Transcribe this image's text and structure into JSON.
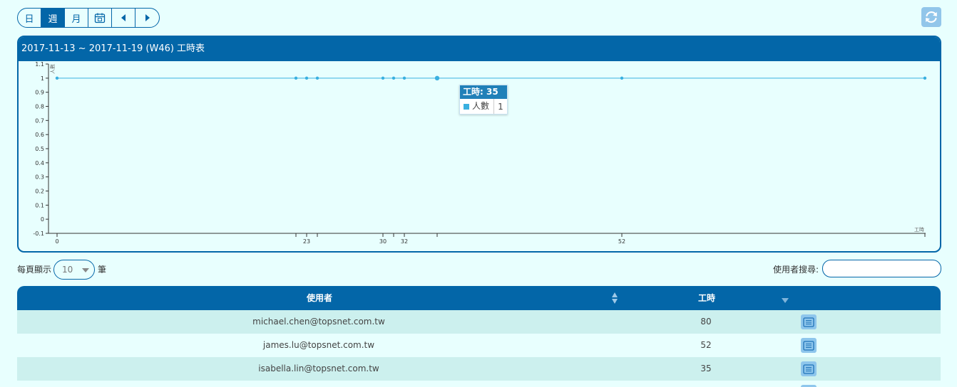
{
  "toolbar": {
    "day_label": "日",
    "week_label": "週",
    "month_label": "月",
    "calendar_icon": "calendar-icon",
    "prev_icon": "caret-left-icon",
    "next_icon": "caret-right-icon",
    "refresh_icon": "refresh-icon"
  },
  "panel": {
    "title": "2017-11-13 ~ 2017-11-19 (W46) 工時表"
  },
  "chart_data": {
    "type": "line",
    "x": [
      0,
      22,
      23,
      24,
      30,
      31,
      32,
      35,
      52,
      80
    ],
    "y": [
      1,
      1,
      1,
      1,
      1,
      1,
      1,
      1,
      1,
      1
    ],
    "xtick_labels": [
      {
        "value": 0,
        "label": "0"
      },
      {
        "value": 23,
        "label": "23"
      },
      {
        "value": 30,
        "label": "30"
      },
      {
        "value": 32,
        "label": "32"
      },
      {
        "value": 52,
        "label": "52"
      }
    ],
    "xticks_unlabeled": [
      22,
      24,
      31,
      35,
      80
    ],
    "yticks": [
      -0.1,
      0,
      0.1,
      0.2,
      0.3,
      0.4,
      0.5,
      0.6,
      0.7,
      0.8,
      0.9,
      1,
      1.1
    ],
    "ylim": [
      -0.1,
      1.1
    ],
    "xlim": [
      0,
      80
    ],
    "xlabel": "工時",
    "ylabel": "人數",
    "grid": false,
    "series_color": "#3ab0e0",
    "highlight_x": 35
  },
  "tooltip": {
    "title": "工時: 35",
    "series_name": "人數",
    "value": "1"
  },
  "controls": {
    "length_prefix": "每頁顯示",
    "length_value": "10",
    "length_suffix": "筆",
    "search_label": "使用者搜尋:",
    "search_value": ""
  },
  "table": {
    "headers": {
      "user": "使用者",
      "hours": "工時"
    },
    "rows": [
      {
        "user": "michael.chen@topsnet.com.tw",
        "hours": "80"
      },
      {
        "user": "james.lu@topsnet.com.tw",
        "hours": "52"
      },
      {
        "user": "isabella.lin@topsnet.com.tw",
        "hours": "35"
      }
    ],
    "row_action_icon": "list-detail-icon"
  },
  "colors": {
    "primary": "#0366a8",
    "background": "#e8fffe",
    "row_stripe": "#ccf0ee",
    "icon_bg": "#8ec6ec",
    "series": "#3ab0e0"
  }
}
